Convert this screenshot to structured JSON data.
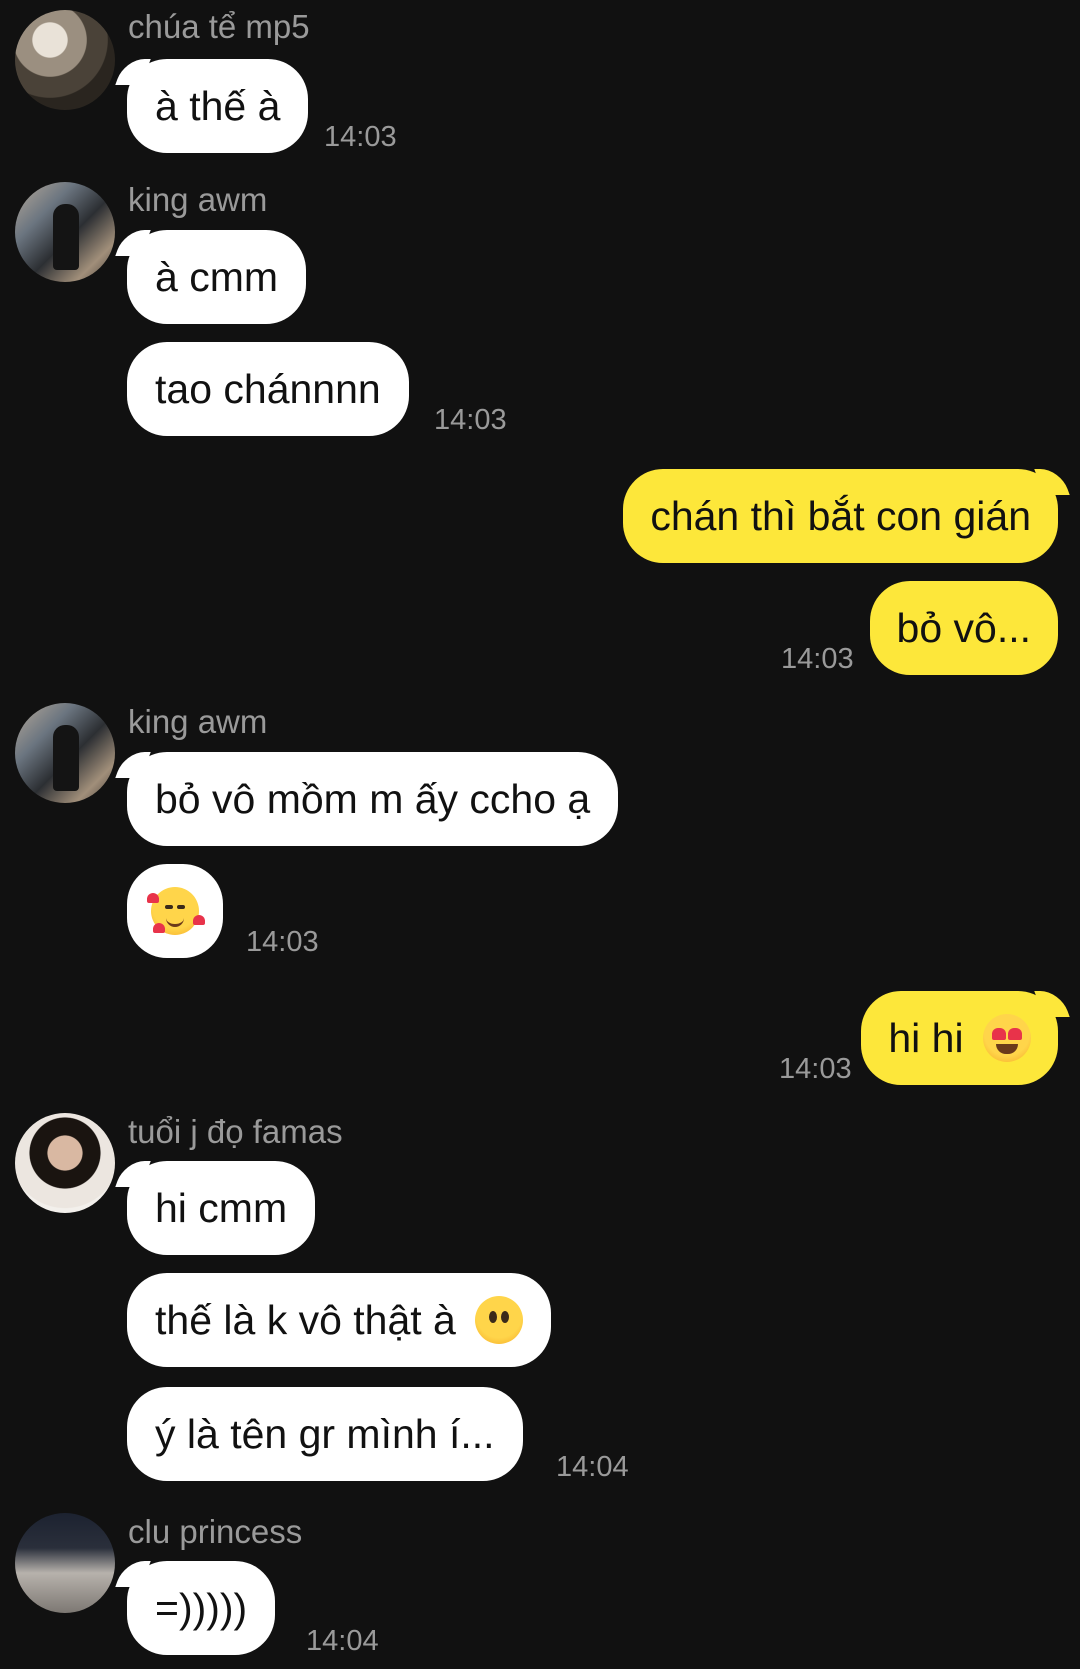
{
  "messages": [
    {
      "sender": "chúa tể mp5",
      "texts": [
        "à thế à"
      ],
      "time": "14:03"
    },
    {
      "sender": "king awm",
      "texts": [
        "à cmm",
        "tao chánnnn"
      ],
      "time": "14:03"
    },
    {
      "outgoing": [
        "chán thì bắt con gián",
        "bỏ vô..."
      ],
      "time": "14:03"
    },
    {
      "sender": "king awm",
      "texts": [
        "bỏ vô mồm m ấy ccho ạ"
      ],
      "emoji": "smiling-face-with-hearts",
      "time": "14:03"
    },
    {
      "outgoing_text": "hi hi",
      "outgoing_emoji": "heart-eyes",
      "time": "14:03"
    },
    {
      "sender": "tuổi j đọ famas",
      "texts": [
        "hi cmm",
        "thế là k vô thật à",
        "ý là tên gr mình í..."
      ],
      "emoji": "face-without-mouth",
      "time": "14:04"
    },
    {
      "sender": "clu princess",
      "texts": [
        "=)))))"
      ],
      "time": "14:04"
    }
  ],
  "colors": {
    "background": "#111111",
    "incoming_bubble": "#ffffff",
    "outgoing_bubble": "#fde73a",
    "meta_text": "#9a9a9a"
  }
}
